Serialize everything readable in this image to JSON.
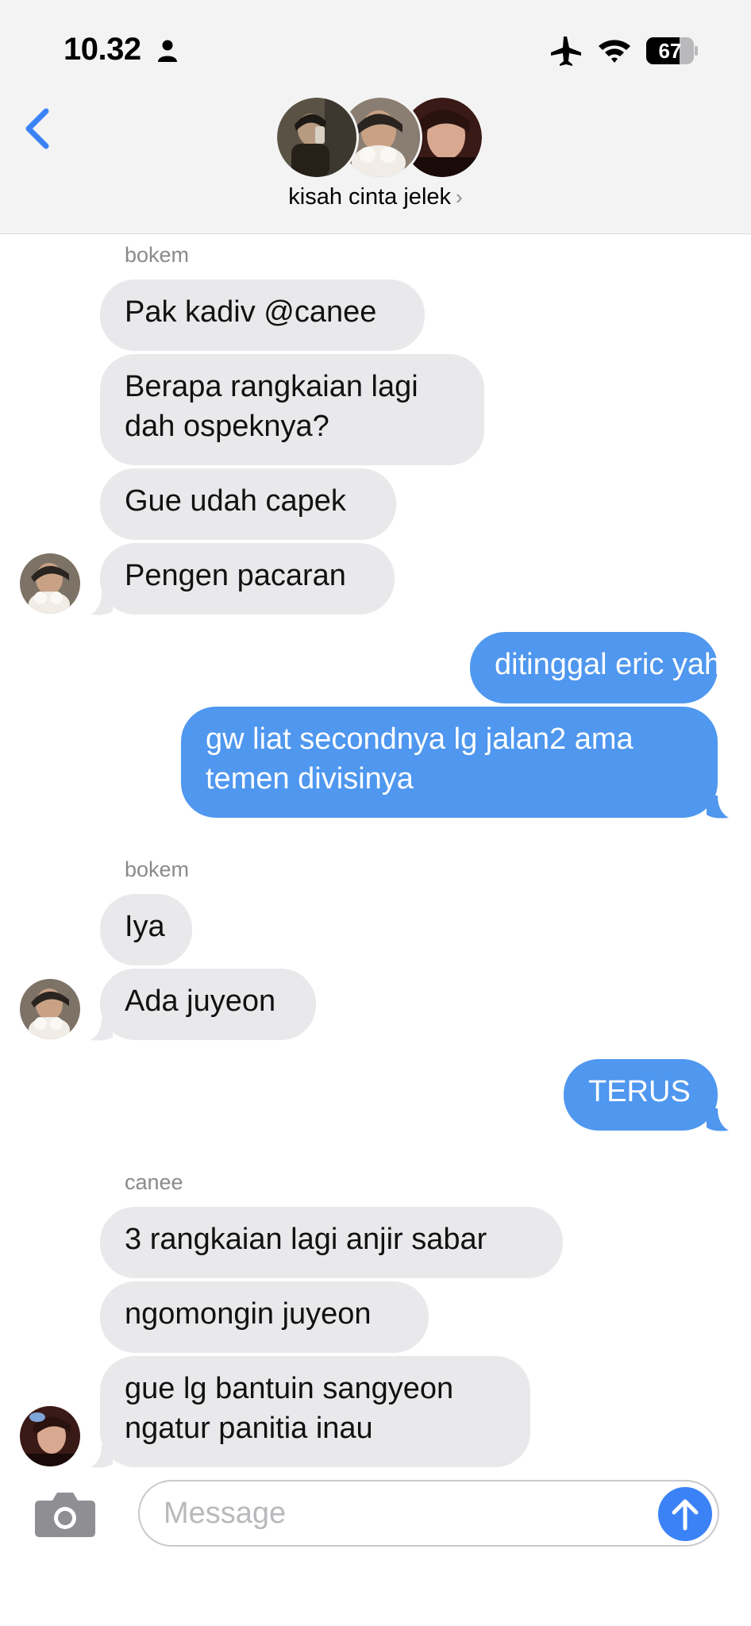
{
  "status_bar": {
    "time": "10.32",
    "battery_level": "67"
  },
  "header": {
    "group_name": "kisah cinta jelek",
    "chevron": "›"
  },
  "messages": {
    "group1": {
      "sender": "bokem",
      "m1": "Pak kadiv @canee",
      "m2_line1": "Berapa rangkaian lagi",
      "m2_line2": "dah ospeknya?",
      "m3": "Gue udah capek",
      "m4": "Pengen pacaran"
    },
    "outgoing1": {
      "m1": "ditinggal eric yah",
      "m2_line1": "gw liat secondnya lg jalan2 ama",
      "m2_line2": "temen divisinya"
    },
    "group2": {
      "sender": "bokem",
      "m1": "Iya",
      "m2": "Ada juyeon"
    },
    "outgoing2": {
      "m1": "TERUS"
    },
    "group3": {
      "sender": "canee",
      "m1": "3 rangkaian lagi anjir sabar",
      "m2": "ngomongin juyeon",
      "m3_line1": "gue lg bantuin sangyeon",
      "m3_line2": "ngatur panitia inau"
    }
  },
  "composer": {
    "placeholder": "Message"
  },
  "colors": {
    "incoming_bubble": "#e9e9eb",
    "outgoing_bubble": "#4f97ef",
    "accent": "#3b82f6"
  }
}
